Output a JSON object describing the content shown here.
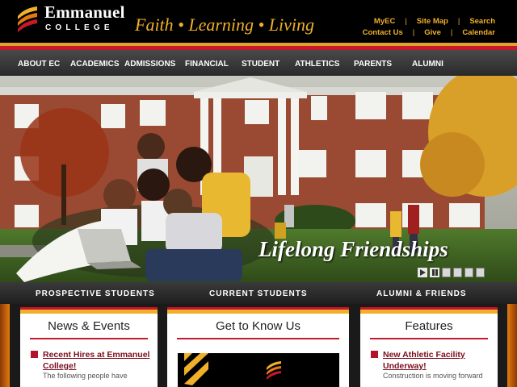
{
  "header": {
    "logo_name": "Emmanuel",
    "logo_college": "COLLEGE",
    "tagline": "Faith • Learning • Living",
    "utility_row1": [
      "MyEC",
      "Site Map",
      "Search"
    ],
    "utility_row2": [
      "Contact Us",
      "Give",
      "Calendar"
    ]
  },
  "nav": {
    "items": [
      "ABOUT EC",
      "ACADEMICS",
      "ADMISSIONS",
      "FINANCIAL",
      "STUDENT",
      "ATHLETICS",
      "PARENTS",
      "ALUMNI"
    ]
  },
  "hero": {
    "caption": "Lifelong Friendships",
    "slide_count": 6
  },
  "audience": {
    "items": [
      "PROSPECTIVE STUDENTS",
      "CURRENT STUDENTS",
      "ALUMNI & FRIENDS"
    ]
  },
  "panels": {
    "news": {
      "heading": "News & Events",
      "story_title": "Recent Hires at Emmanuel College!",
      "story_blurb": "The following people have"
    },
    "know": {
      "heading": "Get to Know Us"
    },
    "features": {
      "heading": "Features",
      "story_title": "New Athletic Facility Underway!",
      "story_blurb": "Construction is moving forward"
    }
  },
  "colors": {
    "gold": "#f0b02a",
    "red": "#c7172b",
    "maroon": "#7a0d1d"
  }
}
